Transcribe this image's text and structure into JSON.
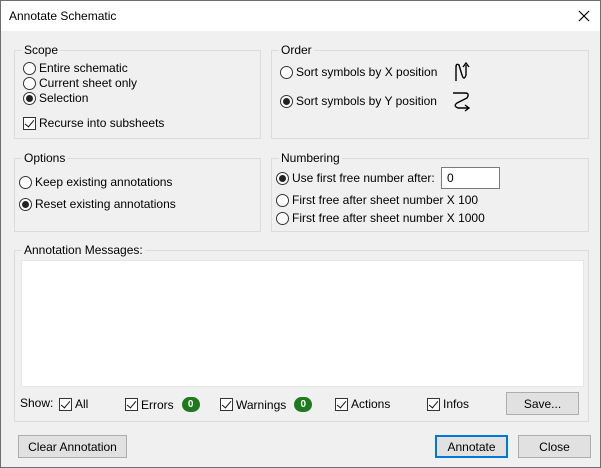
{
  "window": {
    "title": "Annotate Schematic",
    "close_glyph": "✕"
  },
  "scope": {
    "label": "Scope",
    "options": [
      {
        "label": "Entire schematic",
        "selected": false
      },
      {
        "label": "Current sheet only",
        "selected": false
      },
      {
        "label": "Selection",
        "selected": true
      }
    ],
    "recurse": {
      "label": "Recurse into subsheets",
      "checked": true
    }
  },
  "order": {
    "label": "Order",
    "options": [
      {
        "label": "Sort symbols by X position",
        "selected": false,
        "icon": "sort-x-icon"
      },
      {
        "label": "Sort symbols by Y position",
        "selected": true,
        "icon": "sort-y-icon"
      }
    ]
  },
  "options": {
    "label": "Options",
    "items": [
      {
        "label": "Keep existing annotations",
        "selected": false
      },
      {
        "label": "Reset existing annotations",
        "selected": true
      }
    ]
  },
  "numbering": {
    "label": "Numbering",
    "items": [
      {
        "label": "Use first free number after:",
        "selected": true
      },
      {
        "label": "First free after sheet number X 100",
        "selected": false
      },
      {
        "label": "First free after sheet number X 1000",
        "selected": false
      }
    ],
    "first_free_value": "0"
  },
  "messages": {
    "label": "Annotation Messages:",
    "show_label": "Show:",
    "filters": [
      {
        "label": "All",
        "checked": true
      },
      {
        "label": "Errors",
        "checked": true,
        "count": "0"
      },
      {
        "label": "Warnings",
        "checked": true,
        "count": "0"
      },
      {
        "label": "Actions",
        "checked": true
      },
      {
        "label": "Infos",
        "checked": true
      }
    ],
    "save_label": "Save..."
  },
  "buttons": {
    "clear": "Clear Annotation",
    "annotate": "Annotate",
    "close": "Close"
  },
  "colors": {
    "badge": "#1f7a1f",
    "default_button_border": "#0078d7"
  }
}
